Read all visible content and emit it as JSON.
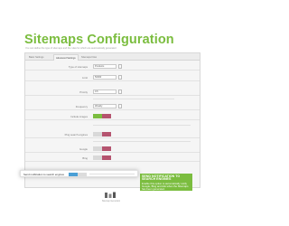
{
  "page": {
    "title": "Sitemaps Configuration",
    "subtitle": "You can define the type of sitemaps and the rules for which are automatically generated"
  },
  "tabs": [
    {
      "label": "Basic Settings"
    },
    {
      "label": "Advanced Settings"
    },
    {
      "label": "Sitemaps Flow"
    }
  ],
  "rows": [
    {
      "label": "Type of sitemaps",
      "value": "Products"
    },
    {
      "label": "Limit",
      "value": "50000"
    },
    {
      "label": "Priority",
      "value": "0.5"
    },
    {
      "label": "Frequency",
      "value": "Weekly"
    },
    {
      "label": "Include images",
      "value": ""
    },
    {
      "label": "Ping search engines",
      "value": ""
    },
    {
      "label": "Google",
      "value": ""
    },
    {
      "label": "Bing",
      "value": ""
    }
  ],
  "highlight": {
    "label": "Send notification to search engines",
    "on_label": "YES",
    "off_label": "NO"
  },
  "callout": {
    "title": "SEND NOTIFICATION TO SEARCH ENGINES",
    "text": "Enable this option to automatically notify Google, Bing and Ask when the Sitemaps has been generated."
  },
  "footer": {
    "brand": "Sitemap Generator"
  },
  "colors": {
    "accent": "#7bbd3f",
    "toggle_on": "#4a9fd6",
    "toggle_off": "#b5546f"
  }
}
